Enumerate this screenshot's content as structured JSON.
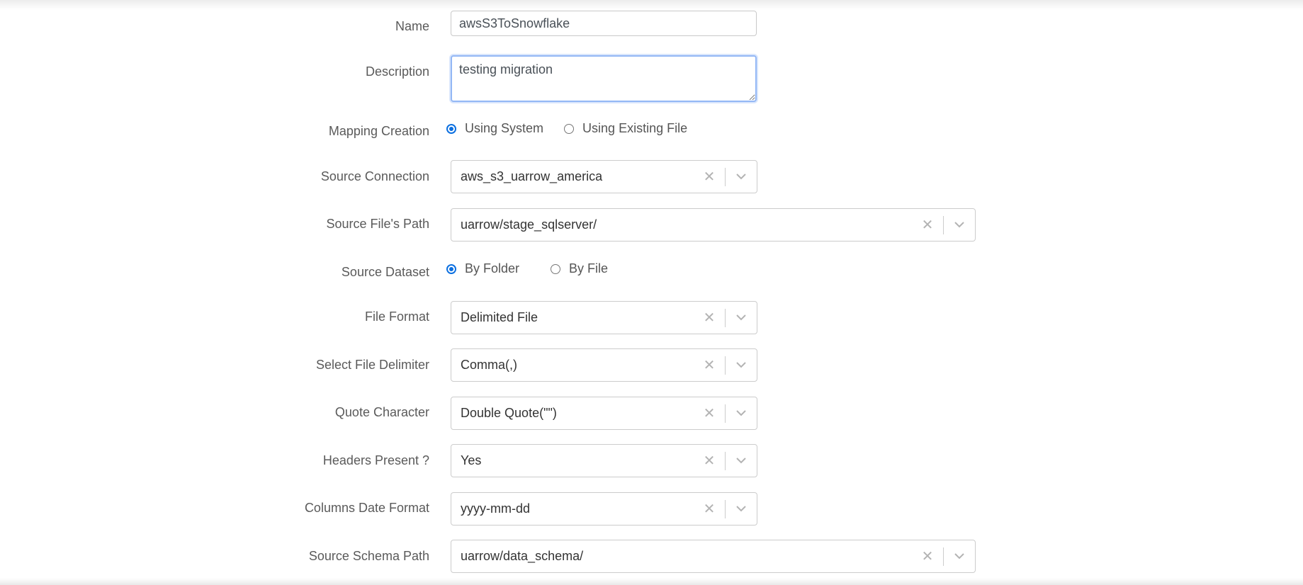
{
  "form": {
    "name": {
      "label": "Name",
      "value": "awsS3ToSnowflake"
    },
    "description": {
      "label": "Description",
      "value": "testing migration"
    },
    "mapping_creation": {
      "label": "Mapping Creation",
      "options": [
        "Using System",
        "Using Existing File"
      ],
      "selected": "Using System"
    },
    "source_connection": {
      "label": "Source Connection",
      "value": "aws_s3_uarrow_america"
    },
    "source_file_path": {
      "label": "Source File's Path",
      "value": "uarrow/stage_sqlserver/"
    },
    "source_dataset": {
      "label": "Source Dataset",
      "options": [
        "By Folder",
        "By File"
      ],
      "selected": "By Folder"
    },
    "file_format": {
      "label": "File Format",
      "value": "Delimited File"
    },
    "file_delimiter": {
      "label": "Select File Delimiter",
      "value": "Comma(,)"
    },
    "quote_character": {
      "label": "Quote Character",
      "value": "Double Quote(\"\")"
    },
    "headers_present": {
      "label": "Headers Present ?",
      "value": "Yes"
    },
    "columns_date_format": {
      "label": "Columns Date Format",
      "value": "yyyy-mm-dd"
    },
    "source_schema_path": {
      "label": "Source Schema Path",
      "value": "uarrow/data_schema/"
    }
  },
  "icons": {
    "clear": "clear-x-icon",
    "dropdown": "chevron-down-icon"
  },
  "colors": {
    "accent": "#0b6fe0",
    "focus_border": "#93b7f5",
    "border": "#cccccc"
  }
}
